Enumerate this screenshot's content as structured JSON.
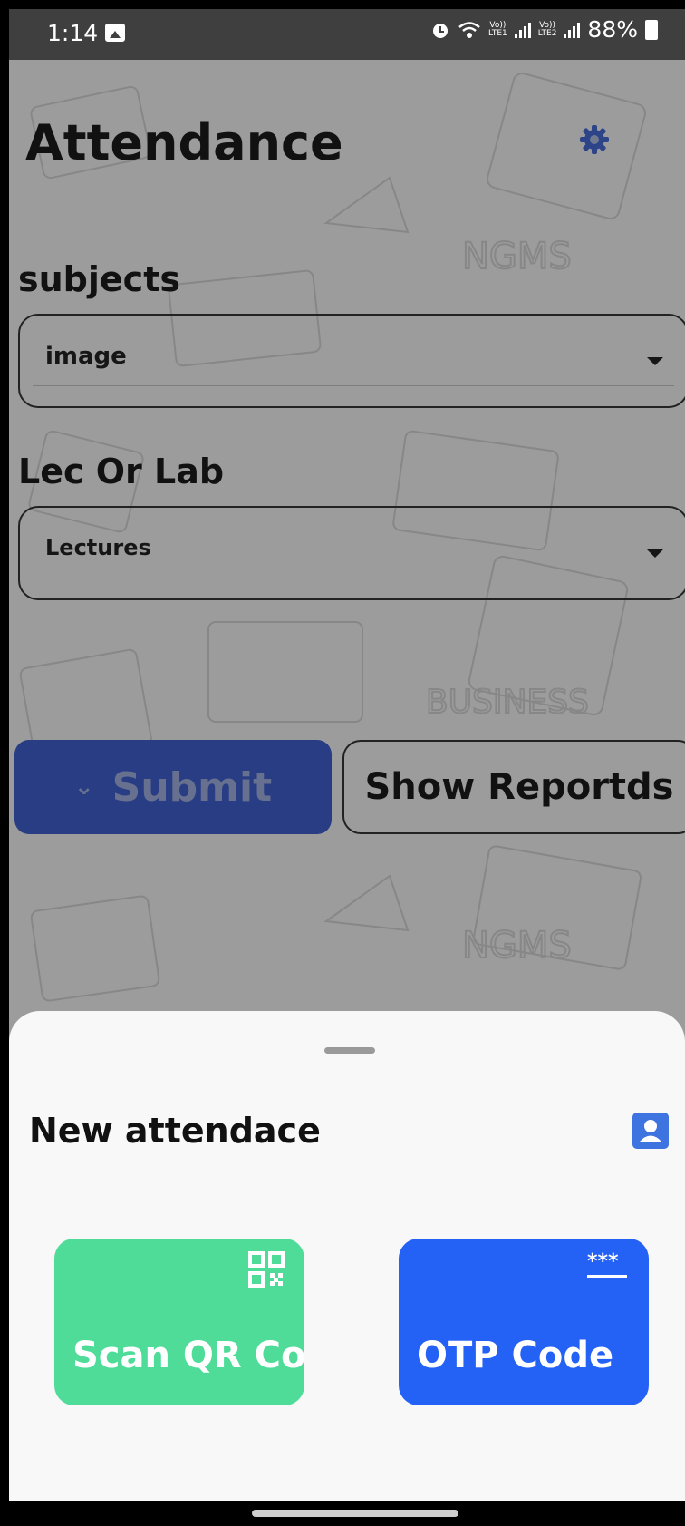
{
  "status_bar": {
    "time": "1:14",
    "network_label_1": "Vo))\nLTE1",
    "network_label_2": "Vo))\nLTE2",
    "battery": "88%"
  },
  "app": {
    "title": "Attendance",
    "subjects_label": "subjects",
    "subjects_value": "image",
    "lec_lab_label": "Lec Or Lab",
    "lec_lab_value": "Lectures",
    "submit_label": "Submit",
    "reports_label": "Show Reportds"
  },
  "sheet": {
    "title": "New attendace",
    "qr_label": "Scan QR Code",
    "otp_label": "OTP Code"
  },
  "colors": {
    "submit": "#3e5cc7",
    "qr_card": "#4edc98",
    "otp_card": "#2461f5",
    "contact_icon": "#3d74e0"
  }
}
